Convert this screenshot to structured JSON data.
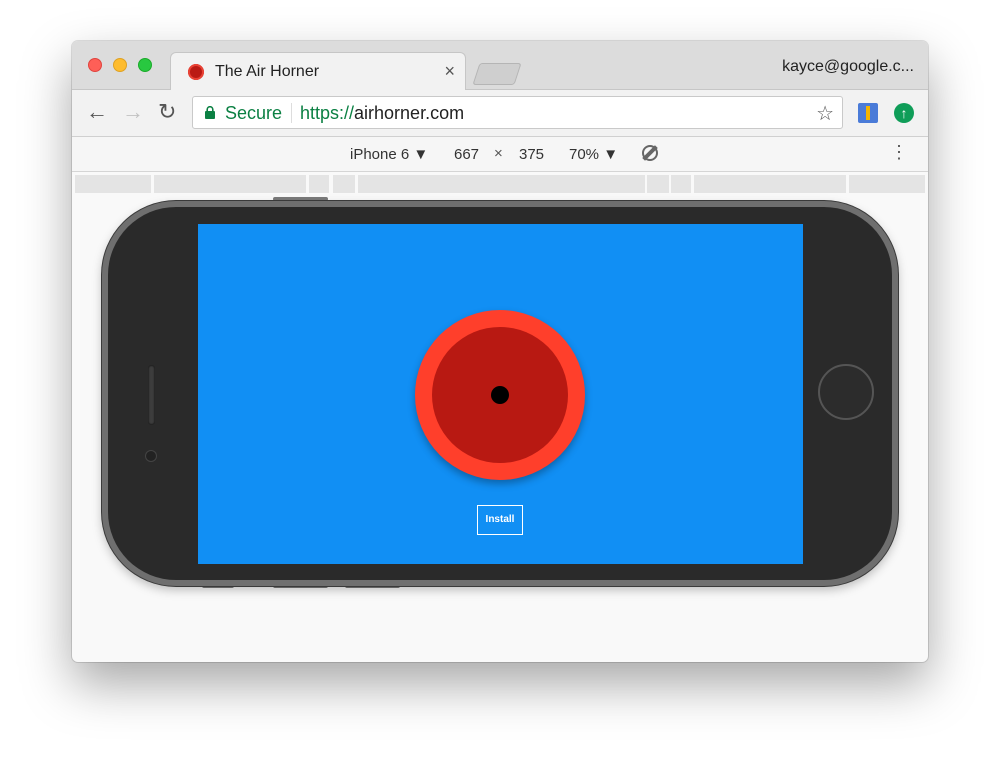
{
  "browser": {
    "tab": {
      "title": "The Air Horner",
      "close_glyph": "×",
      "favicon": "air-horner-favicon"
    },
    "profile": "kayce@google.c...",
    "nav": {
      "back": "←",
      "forward": "→",
      "reload": "↻"
    },
    "omnibox": {
      "security_label": "Secure",
      "url_scheme": "https://",
      "url_rest": "airhorner.com",
      "bookmark_glyph": "☆"
    },
    "extensions": {
      "ext2_glyph": "↑"
    }
  },
  "device_toolbar": {
    "device": "iPhone 6 ▼",
    "width": "667",
    "times": "×",
    "height": "375",
    "zoom": "70% ▼",
    "more": "⋮"
  },
  "page": {
    "install_label": "Install",
    "background_color": "#118ff4",
    "horn_outer_color": "#ff3f2b",
    "horn_inner_color": "#b81912"
  }
}
